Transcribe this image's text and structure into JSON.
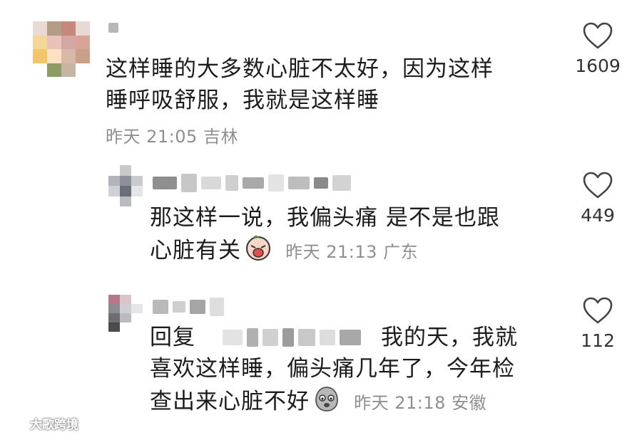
{
  "comments": [
    {
      "text_line1": "这样睡的大多数心脏不太好，因为这样",
      "text_line2": "睡呼吸舒服，我就是这样睡",
      "time": "昨天 21:05",
      "location": "吉林",
      "likes": "1609"
    },
    {
      "text_line1": "那这样一说，我偏头痛 是不是也跟",
      "text_line2": "心脏有关",
      "time": "昨天 21:13",
      "location": "广东",
      "likes": "449"
    },
    {
      "reply_prefix": "回复",
      "text_line1_tail": "我的天，我就",
      "text_line2": "喜欢这样睡，偏头痛几年了，今年检",
      "text_line3": "查出来心脏不好",
      "time": "昨天 21:18",
      "location": "安徽",
      "likes": "112"
    }
  ],
  "watermark": "大歌跨境",
  "icons": {
    "like": "heart-outline-icon",
    "emoji1": "crying-face-emoji",
    "emoji2": "scared-face-emoji",
    "watermark": "logo-icon"
  },
  "colors": {
    "text": "#1c1c1c",
    "meta": "#8f8f8f",
    "heart_stroke": "#444444"
  }
}
